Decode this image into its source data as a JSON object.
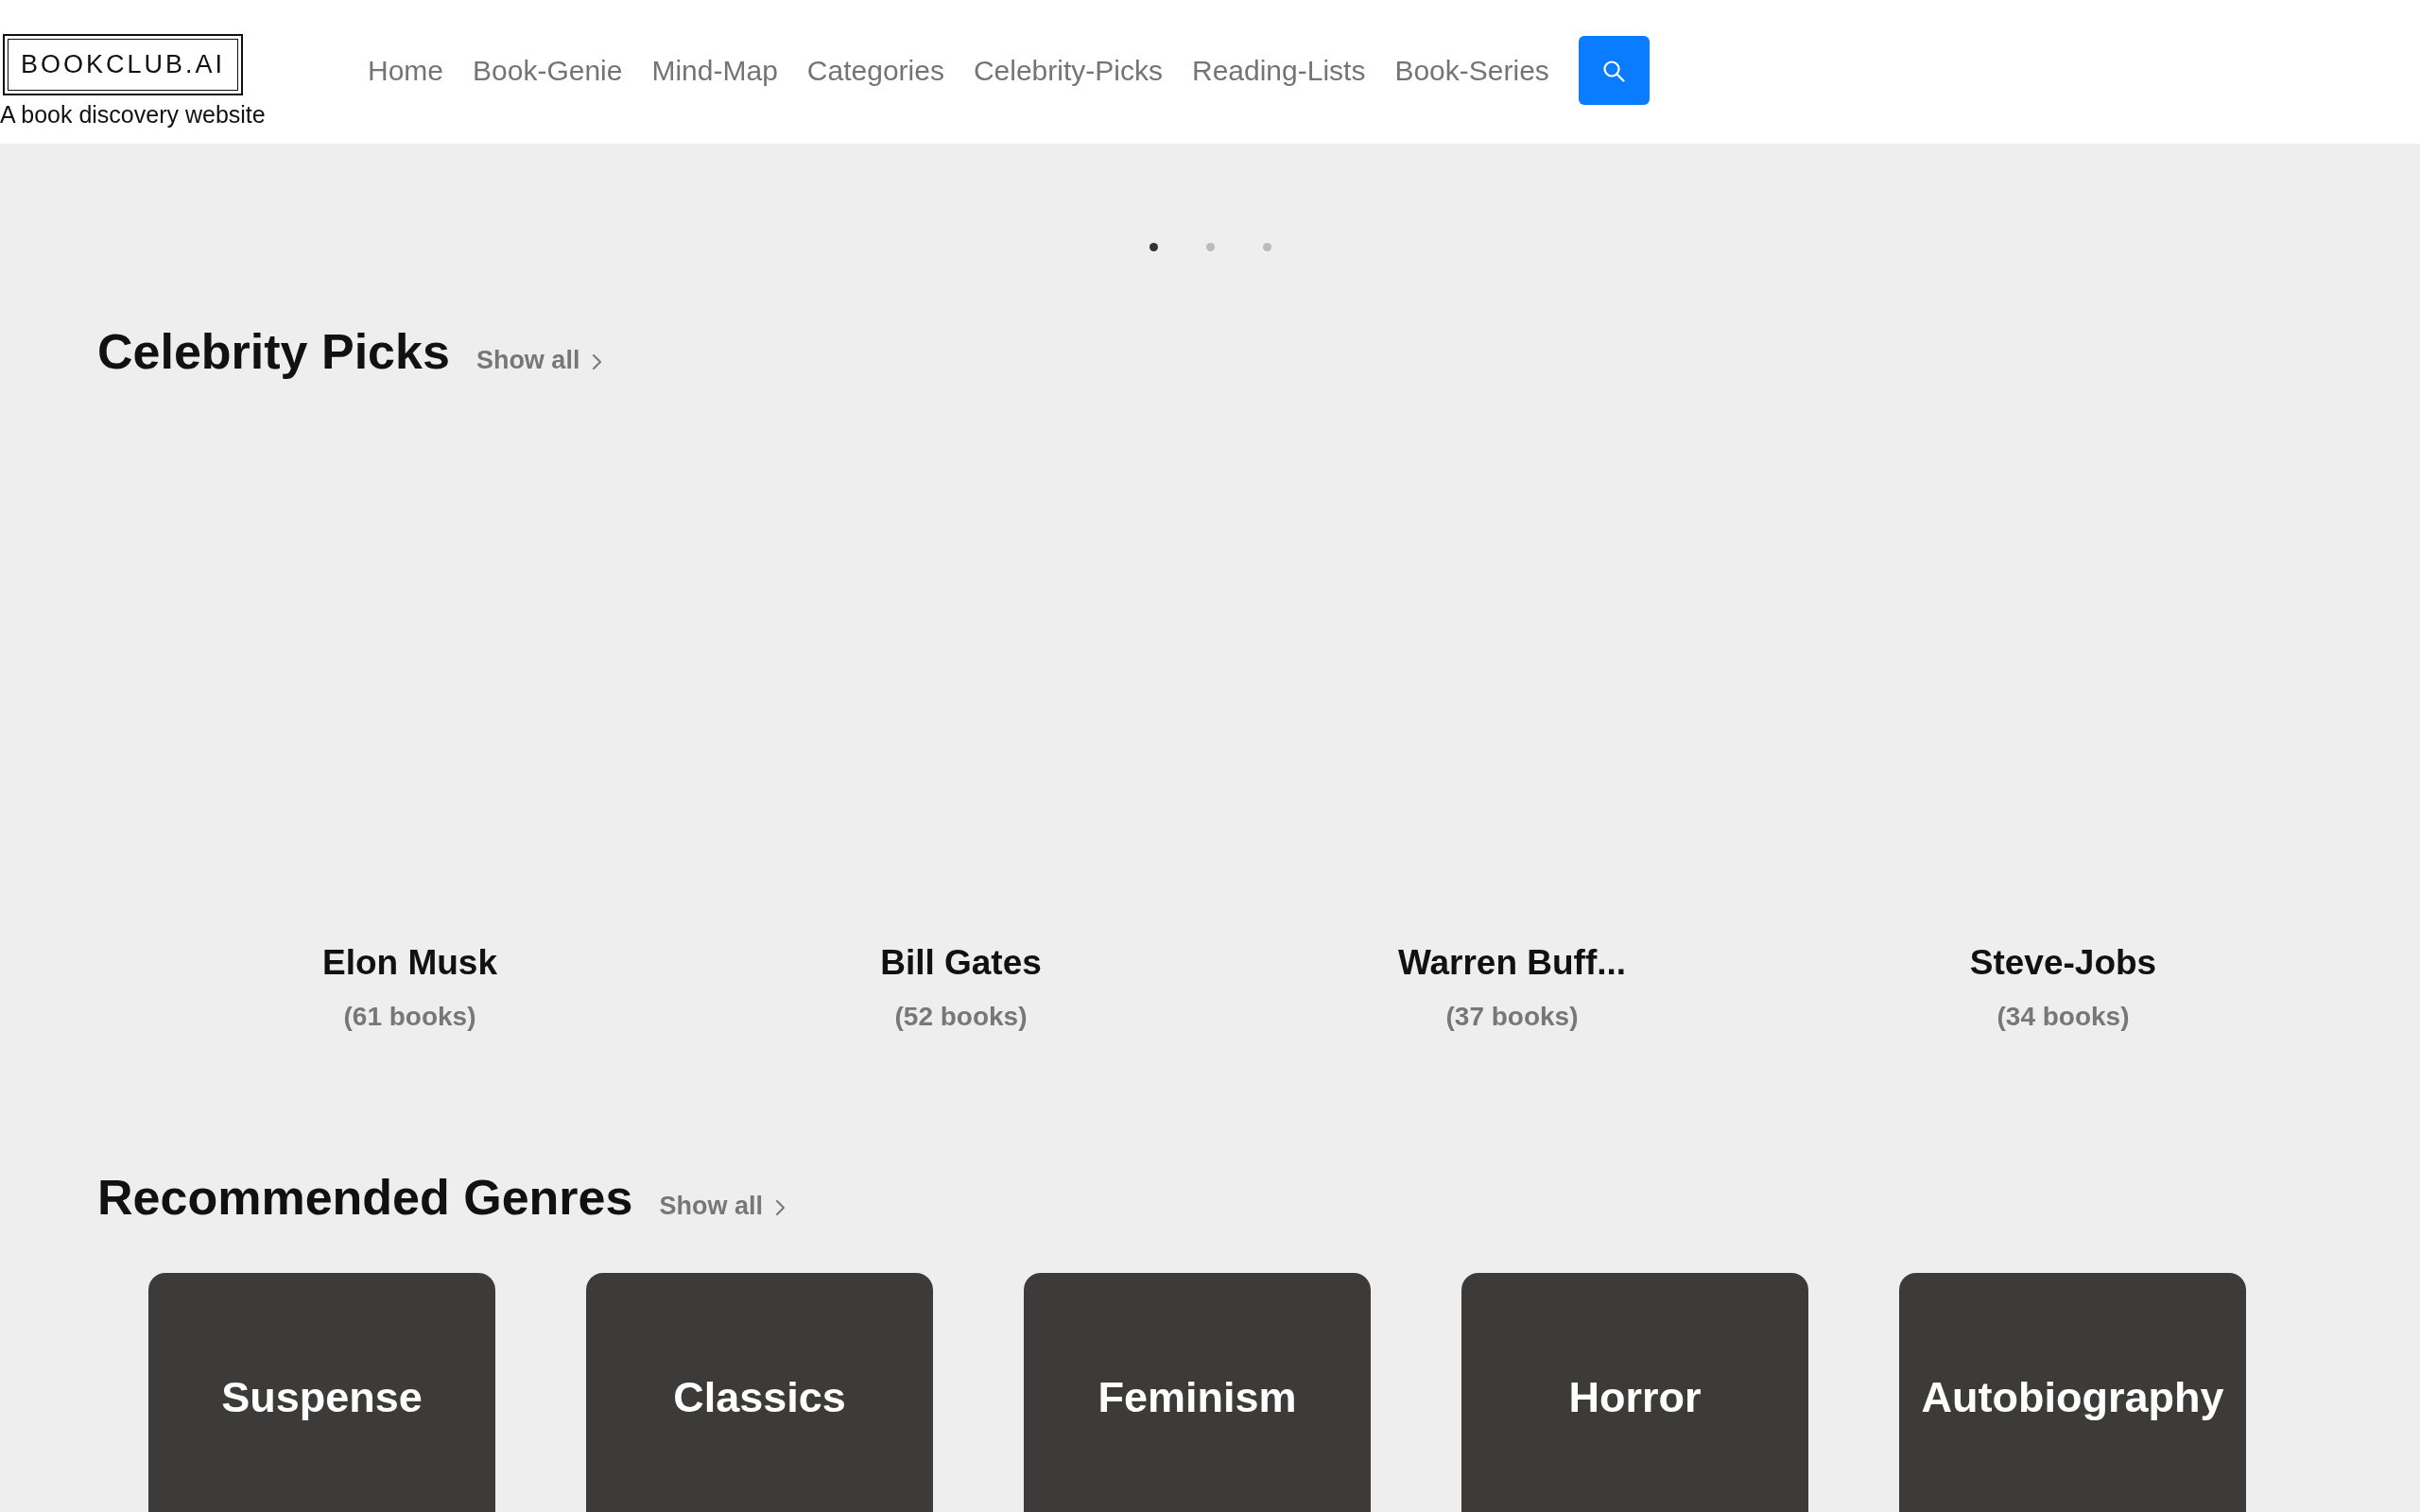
{
  "header": {
    "logo": "BOOKCLUB.AI",
    "tagline": "A book discovery website",
    "nav": [
      {
        "label": "Home"
      },
      {
        "label": "Book-Genie"
      },
      {
        "label": "Mind-Map"
      },
      {
        "label": "Categories"
      },
      {
        "label": "Celebrity-Picks"
      },
      {
        "label": "Reading-Lists"
      },
      {
        "label": "Book-Series"
      }
    ]
  },
  "carousel": {
    "dots": [
      {
        "selected": true
      },
      {
        "selected": false
      },
      {
        "selected": false
      }
    ]
  },
  "celebrity_picks": {
    "title": "Celebrity Picks",
    "show_all": "Show all",
    "items": [
      {
        "name": "Elon Musk",
        "count": "(61 books)"
      },
      {
        "name": "Bill Gates",
        "count": "(52 books)"
      },
      {
        "name": "Warren Buff...",
        "count": "(37 books)"
      },
      {
        "name": "Steve-Jobs",
        "count": "(34 books)"
      }
    ]
  },
  "recommended_genres": {
    "title": "Recommended Genres",
    "show_all": "Show all",
    "items": [
      {
        "name": "Suspense"
      },
      {
        "name": "Classics"
      },
      {
        "name": "Feminism"
      },
      {
        "name": "Horror"
      },
      {
        "name": "Autobiography"
      }
    ]
  }
}
